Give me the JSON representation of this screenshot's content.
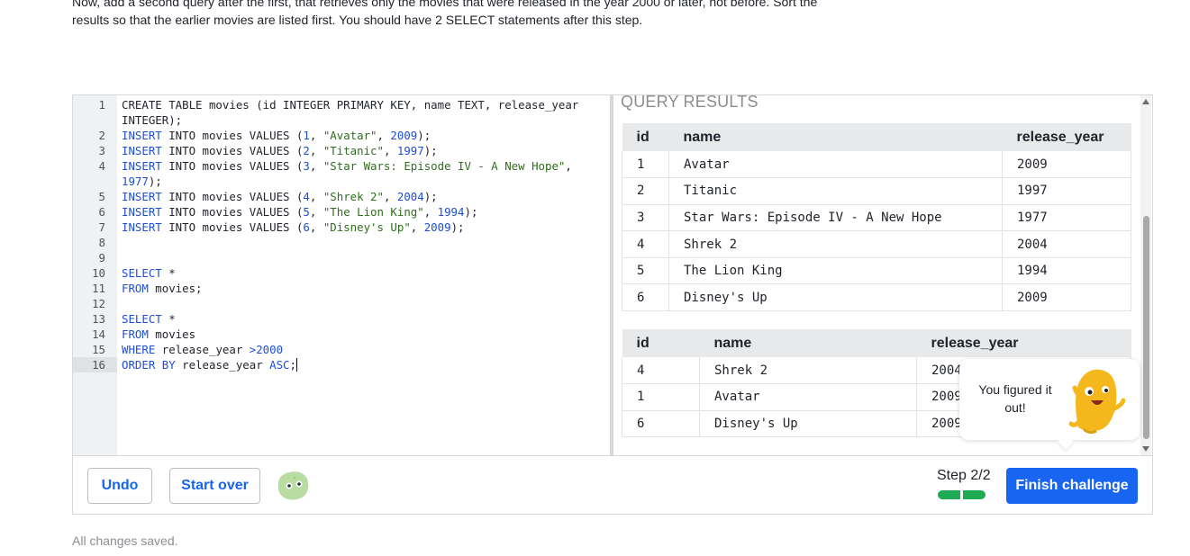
{
  "instructions": {
    "line1": "Now, add a second query after the first, that retrieves only the movies that were released in the year 2000 or later, not before. Sort the",
    "line2": "results so that the earlier movies are listed first. You should have 2 SELECT statements after this step."
  },
  "editor": {
    "lines": [
      {
        "n": "1",
        "segs": [
          [
            "",
            "CREATE TABLE movies (id INTEGER PRIMARY KEY, name TEXT, release_year"
          ]
        ]
      },
      {
        "n": "",
        "segs": [
          [
            "",
            "INTEGER);"
          ]
        ]
      },
      {
        "n": "2",
        "segs": [
          [
            "kw",
            "INSERT"
          ],
          [
            "",
            " INTO movies VALUES ("
          ],
          [
            "num",
            "1"
          ],
          [
            "",
            ", "
          ],
          [
            "str",
            "\"Avatar\""
          ],
          [
            "",
            ", "
          ],
          [
            "num",
            "2009"
          ],
          [
            "",
            ");"
          ]
        ]
      },
      {
        "n": "3",
        "segs": [
          [
            "kw",
            "INSERT"
          ],
          [
            "",
            " INTO movies VALUES ("
          ],
          [
            "num",
            "2"
          ],
          [
            "",
            ", "
          ],
          [
            "str",
            "\"Titanic\""
          ],
          [
            "",
            ", "
          ],
          [
            "num",
            "1997"
          ],
          [
            "",
            ");"
          ]
        ]
      },
      {
        "n": "4",
        "segs": [
          [
            "kw",
            "INSERT"
          ],
          [
            "",
            " INTO movies VALUES ("
          ],
          [
            "num",
            "3"
          ],
          [
            "",
            ", "
          ],
          [
            "str",
            "\"Star Wars: Episode IV - A New Hope\""
          ],
          [
            "",
            ","
          ]
        ]
      },
      {
        "n": "",
        "segs": [
          [
            "num",
            "1977"
          ],
          [
            "",
            ");"
          ]
        ]
      },
      {
        "n": "5",
        "segs": [
          [
            "kw",
            "INSERT"
          ],
          [
            "",
            " INTO movies VALUES ("
          ],
          [
            "num",
            "4"
          ],
          [
            "",
            ", "
          ],
          [
            "str",
            "\"Shrek 2\""
          ],
          [
            "",
            ", "
          ],
          [
            "num",
            "2004"
          ],
          [
            "",
            ");"
          ]
        ]
      },
      {
        "n": "6",
        "segs": [
          [
            "kw",
            "INSERT"
          ],
          [
            "",
            " INTO movies VALUES ("
          ],
          [
            "num",
            "5"
          ],
          [
            "",
            ", "
          ],
          [
            "str",
            "\"The Lion King\""
          ],
          [
            "",
            ", "
          ],
          [
            "num",
            "1994"
          ],
          [
            "",
            ");"
          ]
        ]
      },
      {
        "n": "7",
        "segs": [
          [
            "kw",
            "INSERT"
          ],
          [
            "",
            " INTO movies VALUES ("
          ],
          [
            "num",
            "6"
          ],
          [
            "",
            ", "
          ],
          [
            "str",
            "\"Disney's Up\""
          ],
          [
            "",
            ", "
          ],
          [
            "num",
            "2009"
          ],
          [
            "",
            ");"
          ]
        ]
      },
      {
        "n": "8",
        "segs": [
          [
            "",
            ""
          ]
        ]
      },
      {
        "n": "9",
        "segs": [
          [
            "",
            ""
          ]
        ]
      },
      {
        "n": "10",
        "segs": [
          [
            "kw",
            "SELECT"
          ],
          [
            "",
            " *"
          ]
        ]
      },
      {
        "n": "11",
        "segs": [
          [
            "kw",
            "FROM"
          ],
          [
            "",
            " movies;"
          ]
        ]
      },
      {
        "n": "12",
        "segs": [
          [
            "",
            ""
          ]
        ]
      },
      {
        "n": "13",
        "segs": [
          [
            "kw",
            "SELECT"
          ],
          [
            "",
            " *"
          ]
        ]
      },
      {
        "n": "14",
        "segs": [
          [
            "kw",
            "FROM"
          ],
          [
            "",
            " movies"
          ]
        ]
      },
      {
        "n": "15",
        "segs": [
          [
            "kw",
            "WHERE"
          ],
          [
            "",
            " release_year "
          ],
          [
            "kw",
            ">2000"
          ]
        ]
      },
      {
        "n": "16",
        "segs": [
          [
            "kw",
            "ORDER BY"
          ],
          [
            "",
            " release_year "
          ],
          [
            "kw",
            "ASC"
          ],
          [
            "",
            ";"
          ]
        ],
        "active": true
      }
    ]
  },
  "results": {
    "title": "QUERY RESULTS",
    "table1": {
      "headers": [
        "id",
        "name",
        "release_year"
      ],
      "rows": [
        [
          "1",
          "Avatar",
          "2009"
        ],
        [
          "2",
          "Titanic",
          "1997"
        ],
        [
          "3",
          "Star Wars: Episode IV - A New Hope",
          "1977"
        ],
        [
          "4",
          "Shrek 2",
          "2004"
        ],
        [
          "5",
          "The Lion King",
          "1994"
        ],
        [
          "6",
          "Disney's Up",
          "2009"
        ]
      ]
    },
    "table2": {
      "headers": [
        "id",
        "name",
        "release_year"
      ],
      "rows": [
        [
          "4",
          "Shrek 2",
          "2004"
        ],
        [
          "1",
          "Avatar",
          "2009"
        ],
        [
          "6",
          "Disney's Up",
          "2009"
        ]
      ]
    }
  },
  "toast": {
    "message": "You figured it out!"
  },
  "footer": {
    "undo_label": "Undo",
    "start_over_label": "Start over",
    "step_label": "Step 2/2",
    "finish_label": "Finish challenge"
  },
  "status": {
    "saved_text": "All changes saved."
  },
  "colors": {
    "accent": "#1865f2",
    "progress": "#1fab54"
  }
}
